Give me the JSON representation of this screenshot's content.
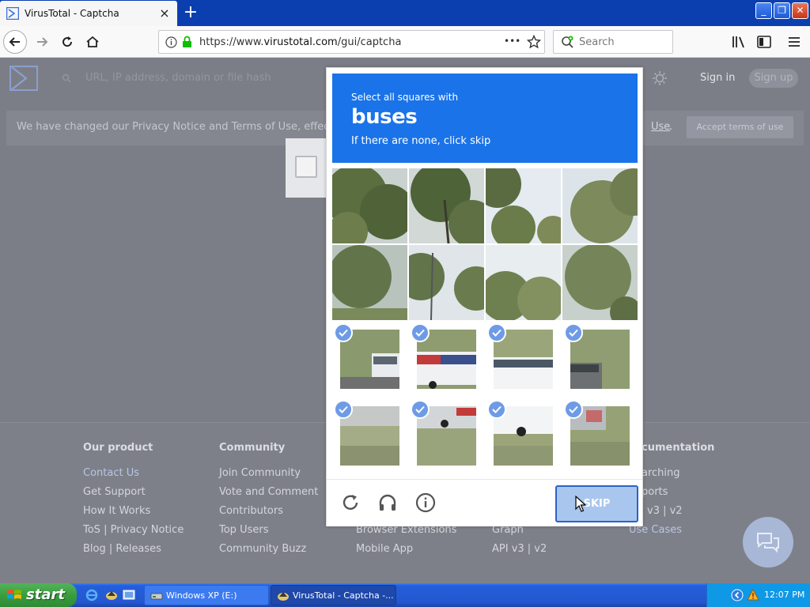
{
  "browser": {
    "tab_title": "VirusTotal - Captcha",
    "tab_close": "×",
    "new_tab": "+",
    "url_prefix": "https://www.",
    "url_domain": "virustotal.com",
    "url_path": "/gui/captcha",
    "page_actions": "•••",
    "search_placeholder": "Search",
    "window_controls": [
      "_",
      "❐",
      "✕"
    ]
  },
  "vt": {
    "search_placeholder": "URL, IP address, domain or file hash",
    "signin": "Sign in",
    "signup": "Sign up",
    "privacy_text": "We have changed our Privacy Notice and Terms of Use, effective J",
    "privacy_link": "Use",
    "privacy_period": ".",
    "accept_button": "Accept terms of use"
  },
  "footer": {
    "columns": [
      {
        "heading": "Our product",
        "links": [
          "Contact Us",
          "Get Support",
          "How It Works",
          "ToS | Privacy Notice",
          "Blog | Releases"
        ]
      },
      {
        "heading": "Community",
        "links": [
          "Join Community",
          "Vote and Comment",
          "Contributors",
          "Top Users",
          "Community Buzz"
        ]
      },
      {
        "heading": "",
        "links": [
          "",
          "",
          "",
          "Browser Extensions",
          "Mobile App"
        ]
      },
      {
        "heading": "",
        "links": [
          "",
          "",
          "",
          "Graph",
          "API v3 | v2"
        ]
      },
      {
        "heading": "cumentation",
        "links": [
          "arching",
          "ports",
          "v3 | v2",
          "Use Cases",
          ""
        ]
      }
    ]
  },
  "captcha": {
    "prompt_line1": "Select all squares with",
    "prompt_target": "buses",
    "prompt_line3": "If there are none, click skip",
    "selected_count": 8,
    "skip_label": "SKIP"
  },
  "colors": {
    "prompt_bg": "#1a73e8",
    "check_bg": "#6e9be6",
    "skip_bg": "#a9c6ee"
  },
  "taskbar": {
    "start_label": "start",
    "tasks": [
      "Windows XP (E:)",
      "VirusTotal - Captcha -..."
    ],
    "clock": "12:07 PM"
  }
}
